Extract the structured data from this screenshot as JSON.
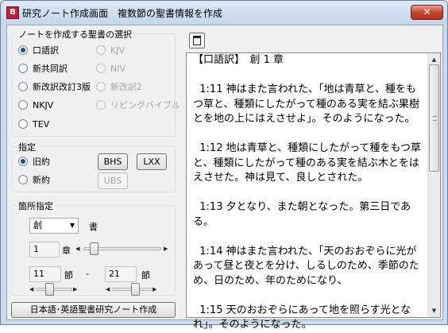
{
  "window": {
    "title": "研究ノート作成画面　複数節の聖書情報を作成",
    "icon": "bible-app-icon",
    "close_glyph": "✕"
  },
  "bible_selection": {
    "group_title": "ノートを作成する聖書の選択",
    "options": [
      {
        "label": "口語訳",
        "checked": true,
        "enabled": true
      },
      {
        "label": "KJV",
        "checked": false,
        "enabled": false
      },
      {
        "label": "新共同訳",
        "checked": false,
        "enabled": true
      },
      {
        "label": "NIV",
        "checked": false,
        "enabled": false
      },
      {
        "label": "新改訳改訂3版",
        "checked": false,
        "enabled": true
      },
      {
        "label": "新改訳2",
        "checked": false,
        "enabled": false
      },
      {
        "label": "NKJV",
        "checked": false,
        "enabled": true
      },
      {
        "label": "リビングバイブル",
        "checked": false,
        "enabled": false
      },
      {
        "label": "TEV",
        "checked": false,
        "enabled": true
      }
    ]
  },
  "testament": {
    "group_title": "指定",
    "options": [
      {
        "label": "旧約",
        "checked": true
      },
      {
        "label": "新約",
        "checked": false
      }
    ],
    "buttons": {
      "bhs": "BHS",
      "lxx": "LXX",
      "ubs": "UBS"
    }
  },
  "passage": {
    "group_title": "箇所指定",
    "book_value": "創",
    "book_label": "書",
    "chapter_value": "1",
    "chapter_label": "章",
    "verse_from": "11",
    "verse_from_label": "節",
    "dash": "-",
    "verse_to": "21",
    "verse_to_label": "節",
    "chapter_slider": 0.1,
    "verse_from_slider": 0.3,
    "verse_to_slider": 0.45
  },
  "create_button": "日本語･英語聖書研究ノート作成",
  "text": {
    "content": "【口語訳】　創 1 章\n\n  1:11 神はまた言われた、「地は青草と、種をもつ草と、種類にしたがって種のある実を結ぶ果樹とを地の上にはえさせよ」。そのようになった。\n\n  1:12 地は青草と、種類にしたがって種をもつ草と、種類にしたがって種のある実を結ぶ木とをはえさせた。神は見て、良しとされた。\n\n  1:13 夕となり、また朝となった。第三日である。\n\n  1:14 神はまた言われた、「天のおおぞらに光があって昼と夜とを分け、しるしのため、季節のため、日のため、年のためになり、\n\n  1:15 天のおおぞらにあって地を照らす光となれ」。そのようになった。"
  }
}
